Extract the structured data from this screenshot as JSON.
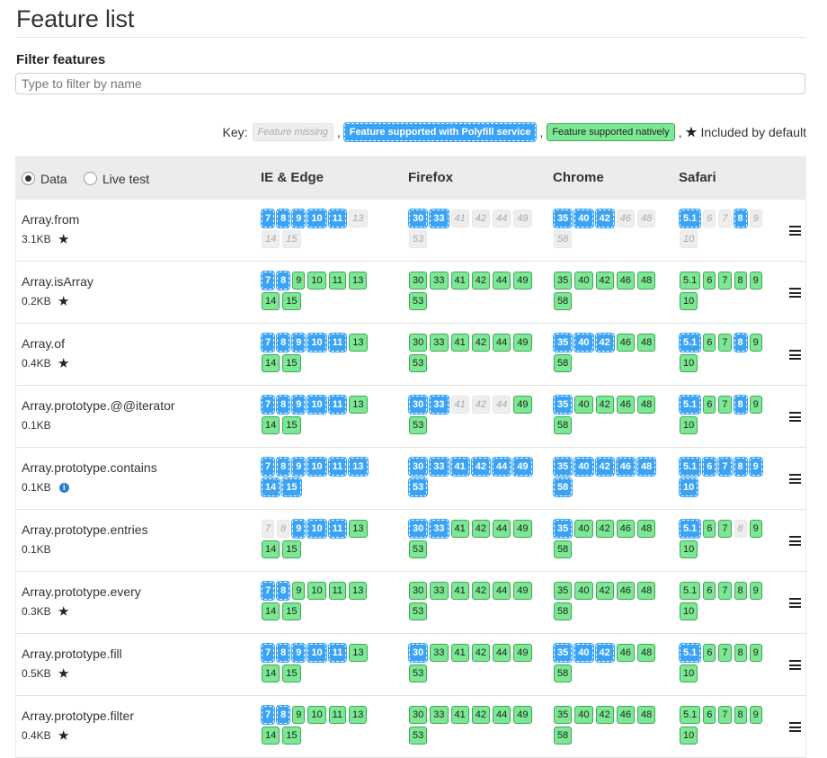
{
  "page": {
    "title": "Feature list",
    "filter_label": "Filter features",
    "filter_placeholder": "Type to filter by name",
    "key": {
      "label": "Key:",
      "missing": "Feature missing",
      "polyfill": "Feature supported with Polyfill service",
      "native": "Feature supported natively",
      "default": "Included by default",
      "comma": ","
    }
  },
  "colors": {
    "polyfill": "#3ba3f5",
    "native": "#7ce893",
    "missing": "#eeeeee",
    "header_bg": "#ececec"
  },
  "table": {
    "mode_options": [
      {
        "label": "Data",
        "selected": true
      },
      {
        "label": "Live test",
        "selected": false
      }
    ],
    "columns": [
      "IE & Edge",
      "Firefox",
      "Chrome",
      "Safari"
    ],
    "rows": [
      {
        "name": "Array.from",
        "size": "3.1KB",
        "icon": "star-icon",
        "ie": [
          [
            "7",
            "p"
          ],
          [
            "8",
            "p"
          ],
          [
            "9",
            "p"
          ],
          [
            "10",
            "p"
          ],
          [
            "11",
            "p"
          ],
          [
            "13",
            "m"
          ],
          [
            "14",
            "m"
          ],
          [
            "15",
            "m"
          ]
        ],
        "firefox": [
          [
            "30",
            "p"
          ],
          [
            "33",
            "p"
          ],
          [
            "41",
            "m"
          ],
          [
            "42",
            "m"
          ],
          [
            "44",
            "m"
          ],
          [
            "49",
            "m"
          ],
          [
            "53",
            "m"
          ]
        ],
        "chrome": [
          [
            "35",
            "p"
          ],
          [
            "40",
            "p"
          ],
          [
            "42",
            "p"
          ],
          [
            "46",
            "m"
          ],
          [
            "48",
            "m"
          ],
          [
            "58",
            "m"
          ]
        ],
        "safari": [
          [
            "5.1",
            "p"
          ],
          [
            "6",
            "m"
          ],
          [
            "7",
            "m"
          ],
          [
            "8",
            "p"
          ],
          [
            "9",
            "m"
          ],
          [
            "10",
            "m"
          ]
        ]
      },
      {
        "name": "Array.isArray",
        "size": "0.2KB",
        "icon": "star-icon",
        "ie": [
          [
            "7",
            "p"
          ],
          [
            "8",
            "p"
          ],
          [
            "9",
            "n"
          ],
          [
            "10",
            "n"
          ],
          [
            "11",
            "n"
          ],
          [
            "13",
            "n"
          ],
          [
            "14",
            "n"
          ],
          [
            "15",
            "n"
          ]
        ],
        "firefox": [
          [
            "30",
            "n"
          ],
          [
            "33",
            "n"
          ],
          [
            "41",
            "n"
          ],
          [
            "42",
            "n"
          ],
          [
            "44",
            "n"
          ],
          [
            "49",
            "n"
          ],
          [
            "53",
            "n"
          ]
        ],
        "chrome": [
          [
            "35",
            "n"
          ],
          [
            "40",
            "n"
          ],
          [
            "42",
            "n"
          ],
          [
            "46",
            "n"
          ],
          [
            "48",
            "n"
          ],
          [
            "58",
            "n"
          ]
        ],
        "safari": [
          [
            "5.1",
            "n"
          ],
          [
            "6",
            "n"
          ],
          [
            "7",
            "n"
          ],
          [
            "8",
            "n"
          ],
          [
            "9",
            "n"
          ],
          [
            "10",
            "n"
          ]
        ]
      },
      {
        "name": "Array.of",
        "size": "0.4KB",
        "icon": "star-icon",
        "ie": [
          [
            "7",
            "p"
          ],
          [
            "8",
            "p"
          ],
          [
            "9",
            "p"
          ],
          [
            "10",
            "p"
          ],
          [
            "11",
            "p"
          ],
          [
            "13",
            "n"
          ],
          [
            "14",
            "n"
          ],
          [
            "15",
            "n"
          ]
        ],
        "firefox": [
          [
            "30",
            "n"
          ],
          [
            "33",
            "n"
          ],
          [
            "41",
            "n"
          ],
          [
            "42",
            "n"
          ],
          [
            "44",
            "n"
          ],
          [
            "49",
            "n"
          ],
          [
            "53",
            "n"
          ]
        ],
        "chrome": [
          [
            "35",
            "p"
          ],
          [
            "40",
            "p"
          ],
          [
            "42",
            "p"
          ],
          [
            "46",
            "n"
          ],
          [
            "48",
            "n"
          ],
          [
            "58",
            "n"
          ]
        ],
        "safari": [
          [
            "5.1",
            "p"
          ],
          [
            "6",
            "n"
          ],
          [
            "7",
            "n"
          ],
          [
            "8",
            "p"
          ],
          [
            "9",
            "n"
          ],
          [
            "10",
            "n"
          ]
        ]
      },
      {
        "name": "Array.prototype.@@iterator",
        "size": "0.1KB",
        "icon": "",
        "ie": [
          [
            "7",
            "p"
          ],
          [
            "8",
            "p"
          ],
          [
            "9",
            "p"
          ],
          [
            "10",
            "p"
          ],
          [
            "11",
            "p"
          ],
          [
            "13",
            "n"
          ],
          [
            "14",
            "n"
          ],
          [
            "15",
            "n"
          ]
        ],
        "firefox": [
          [
            "30",
            "p"
          ],
          [
            "33",
            "p"
          ],
          [
            "41",
            "m"
          ],
          [
            "42",
            "m"
          ],
          [
            "44",
            "m"
          ],
          [
            "49",
            "n"
          ],
          [
            "53",
            "n"
          ]
        ],
        "chrome": [
          [
            "35",
            "p"
          ],
          [
            "40",
            "n"
          ],
          [
            "42",
            "n"
          ],
          [
            "46",
            "n"
          ],
          [
            "48",
            "n"
          ],
          [
            "58",
            "n"
          ]
        ],
        "safari": [
          [
            "5.1",
            "p"
          ],
          [
            "6",
            "n"
          ],
          [
            "7",
            "n"
          ],
          [
            "8",
            "p"
          ],
          [
            "9",
            "n"
          ],
          [
            "10",
            "n"
          ]
        ]
      },
      {
        "name": "Array.prototype.contains",
        "size": "0.1KB",
        "icon": "info-icon",
        "ie": [
          [
            "7",
            "p"
          ],
          [
            "8",
            "p"
          ],
          [
            "9",
            "p"
          ],
          [
            "10",
            "p"
          ],
          [
            "11",
            "p"
          ],
          [
            "13",
            "p"
          ],
          [
            "14",
            "p"
          ],
          [
            "15",
            "p"
          ]
        ],
        "firefox": [
          [
            "30",
            "p"
          ],
          [
            "33",
            "p"
          ],
          [
            "41",
            "p"
          ],
          [
            "42",
            "p"
          ],
          [
            "44",
            "p"
          ],
          [
            "49",
            "p"
          ],
          [
            "53",
            "p"
          ]
        ],
        "chrome": [
          [
            "35",
            "p"
          ],
          [
            "40",
            "p"
          ],
          [
            "42",
            "p"
          ],
          [
            "46",
            "p"
          ],
          [
            "48",
            "p"
          ],
          [
            "58",
            "p"
          ]
        ],
        "safari": [
          [
            "5.1",
            "p"
          ],
          [
            "6",
            "p"
          ],
          [
            "7",
            "p"
          ],
          [
            "8",
            "p"
          ],
          [
            "9",
            "p"
          ],
          [
            "10",
            "p"
          ]
        ]
      },
      {
        "name": "Array.prototype.entries",
        "size": "0.1KB",
        "icon": "",
        "ie": [
          [
            "7",
            "m"
          ],
          [
            "8",
            "m"
          ],
          [
            "9",
            "p"
          ],
          [
            "10",
            "p"
          ],
          [
            "11",
            "p"
          ],
          [
            "13",
            "n"
          ],
          [
            "14",
            "n"
          ],
          [
            "15",
            "n"
          ]
        ],
        "firefox": [
          [
            "30",
            "p"
          ],
          [
            "33",
            "p"
          ],
          [
            "41",
            "n"
          ],
          [
            "42",
            "n"
          ],
          [
            "44",
            "n"
          ],
          [
            "49",
            "n"
          ],
          [
            "53",
            "n"
          ]
        ],
        "chrome": [
          [
            "35",
            "p"
          ],
          [
            "40",
            "n"
          ],
          [
            "42",
            "n"
          ],
          [
            "46",
            "n"
          ],
          [
            "48",
            "n"
          ],
          [
            "58",
            "n"
          ]
        ],
        "safari": [
          [
            "5.1",
            "p"
          ],
          [
            "6",
            "n"
          ],
          [
            "7",
            "n"
          ],
          [
            "8",
            "m"
          ],
          [
            "9",
            "n"
          ],
          [
            "10",
            "n"
          ]
        ]
      },
      {
        "name": "Array.prototype.every",
        "size": "0.3KB",
        "icon": "star-icon",
        "ie": [
          [
            "7",
            "p"
          ],
          [
            "8",
            "p"
          ],
          [
            "9",
            "n"
          ],
          [
            "10",
            "n"
          ],
          [
            "11",
            "n"
          ],
          [
            "13",
            "n"
          ],
          [
            "14",
            "n"
          ],
          [
            "15",
            "n"
          ]
        ],
        "firefox": [
          [
            "30",
            "n"
          ],
          [
            "33",
            "n"
          ],
          [
            "41",
            "n"
          ],
          [
            "42",
            "n"
          ],
          [
            "44",
            "n"
          ],
          [
            "49",
            "n"
          ],
          [
            "53",
            "n"
          ]
        ],
        "chrome": [
          [
            "35",
            "n"
          ],
          [
            "40",
            "n"
          ],
          [
            "42",
            "n"
          ],
          [
            "46",
            "n"
          ],
          [
            "48",
            "n"
          ],
          [
            "58",
            "n"
          ]
        ],
        "safari": [
          [
            "5.1",
            "n"
          ],
          [
            "6",
            "n"
          ],
          [
            "7",
            "n"
          ],
          [
            "8",
            "n"
          ],
          [
            "9",
            "n"
          ],
          [
            "10",
            "n"
          ]
        ]
      },
      {
        "name": "Array.prototype.fill",
        "size": "0.5KB",
        "icon": "star-icon",
        "ie": [
          [
            "7",
            "p"
          ],
          [
            "8",
            "p"
          ],
          [
            "9",
            "p"
          ],
          [
            "10",
            "p"
          ],
          [
            "11",
            "p"
          ],
          [
            "13",
            "n"
          ],
          [
            "14",
            "n"
          ],
          [
            "15",
            "n"
          ]
        ],
        "firefox": [
          [
            "30",
            "p"
          ],
          [
            "33",
            "n"
          ],
          [
            "41",
            "n"
          ],
          [
            "42",
            "n"
          ],
          [
            "44",
            "n"
          ],
          [
            "49",
            "n"
          ],
          [
            "53",
            "n"
          ]
        ],
        "chrome": [
          [
            "35",
            "p"
          ],
          [
            "40",
            "p"
          ],
          [
            "42",
            "p"
          ],
          [
            "46",
            "n"
          ],
          [
            "48",
            "n"
          ],
          [
            "58",
            "n"
          ]
        ],
        "safari": [
          [
            "5.1",
            "p"
          ],
          [
            "6",
            "n"
          ],
          [
            "7",
            "n"
          ],
          [
            "8",
            "n"
          ],
          [
            "9",
            "n"
          ],
          [
            "10",
            "n"
          ]
        ]
      },
      {
        "name": "Array.prototype.filter",
        "size": "0.4KB",
        "icon": "star-icon",
        "ie": [
          [
            "7",
            "p"
          ],
          [
            "8",
            "p"
          ],
          [
            "9",
            "n"
          ],
          [
            "10",
            "n"
          ],
          [
            "11",
            "n"
          ],
          [
            "13",
            "n"
          ],
          [
            "14",
            "n"
          ],
          [
            "15",
            "n"
          ]
        ],
        "firefox": [
          [
            "30",
            "n"
          ],
          [
            "33",
            "n"
          ],
          [
            "41",
            "n"
          ],
          [
            "42",
            "n"
          ],
          [
            "44",
            "n"
          ],
          [
            "49",
            "n"
          ],
          [
            "53",
            "n"
          ]
        ],
        "chrome": [
          [
            "35",
            "n"
          ],
          [
            "40",
            "n"
          ],
          [
            "42",
            "n"
          ],
          [
            "46",
            "n"
          ],
          [
            "48",
            "n"
          ],
          [
            "58",
            "n"
          ]
        ],
        "safari": [
          [
            "5.1",
            "n"
          ],
          [
            "6",
            "n"
          ],
          [
            "7",
            "n"
          ],
          [
            "8",
            "n"
          ],
          [
            "9",
            "n"
          ],
          [
            "10",
            "n"
          ]
        ]
      }
    ]
  }
}
